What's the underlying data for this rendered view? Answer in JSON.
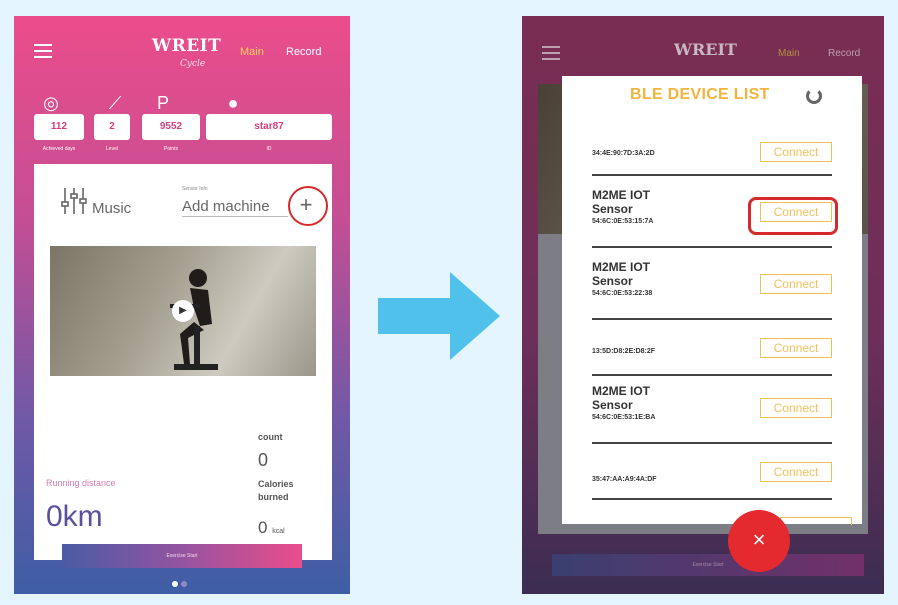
{
  "left_phone": {
    "logo": "WREIT",
    "logo_sub": "Cycle",
    "nav": {
      "main": "Main",
      "record": "Record"
    },
    "stats": [
      {
        "value": "112",
        "caption": "Achieved days",
        "icon": "target-icon"
      },
      {
        "value": "2",
        "caption": "Level",
        "icon": "level-chart-icon"
      },
      {
        "value": "9552",
        "caption": "Points",
        "icon": "points-flag-icon"
      },
      {
        "value": "star87",
        "caption": "ID",
        "icon": "user-icon"
      }
    ],
    "music_label": "Music",
    "sensor_caption": "Sensor Info",
    "add_machine": "Add machine",
    "count_label": "count",
    "count_value": "0",
    "calories_label": "Calories burned",
    "calories_value": "0",
    "calories_unit": "kcal",
    "running_label": "Running distance",
    "running_value": "0km",
    "start_button": "Exercise Start"
  },
  "right_phone": {
    "logo": "WREIT",
    "nav": {
      "main": "Main",
      "record": "Record"
    },
    "start_button": "Exercise Start",
    "ble_title": "BLE DEVICE LIST",
    "devices": [
      {
        "name": "",
        "address": "34:4E:90:7D:3A:2D",
        "button": "Connect"
      },
      {
        "name": "M2ME  IOT Sensor",
        "address": "54:6C:0E:53:15:7A",
        "button": "Connect"
      },
      {
        "name": "M2ME  IOT Sensor",
        "address": "54:6C:0E:53:22:38",
        "button": "Connect"
      },
      {
        "name": "",
        "address": "13:5D:D8:2E:D8:2F",
        "button": "Connect"
      },
      {
        "name": "M2ME  IOT Sensor",
        "address": "54:6C:0E:53:1E:BA",
        "button": "Connect"
      },
      {
        "name": "",
        "address": "35:47:AA:A9:4A:DF",
        "button": "Connect"
      }
    ],
    "close_icon": "×"
  },
  "colors": {
    "accent_pink": "#ec4d8a",
    "accent_yellow": "#f3b33d",
    "highlight_red": "#d42a2e",
    "arrow_blue": "#4fc1ea"
  }
}
